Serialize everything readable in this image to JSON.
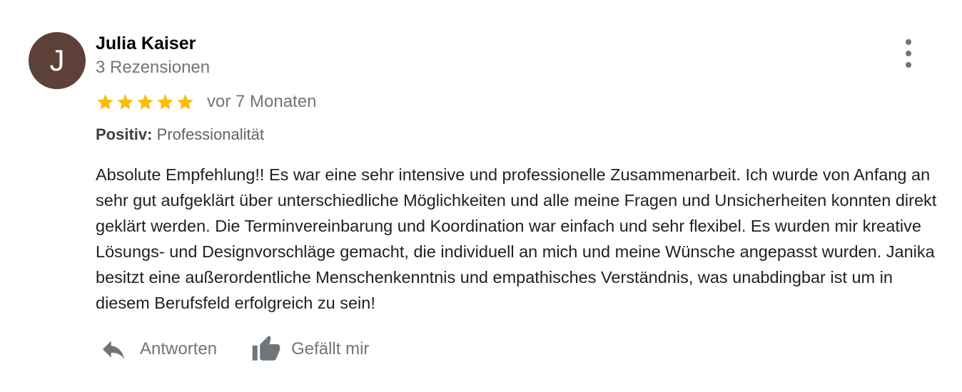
{
  "review": {
    "author_name": "Julia Kaiser",
    "author_initial": "J",
    "review_count": "3 Rezensionen",
    "rating": 5,
    "rating_max": 5,
    "time_ago": "vor 7 Monaten",
    "positive_label": "Positiv:",
    "positive_value": "Professionalität",
    "text": "Absolute Empfehlung!! Es war eine sehr intensive und professionelle Zusammenarbeit. Ich wurde von Anfang an sehr gut aufgeklärt über unterschiedliche Möglichkeiten und alle meine Fragen und Unsicherheiten konnten direkt geklärt werden. Die Terminvereinbarung und Koordination war einfach und sehr flexibel. Es wurden mir kreative Lösungs- und Designvorschläge gemacht, die individuell an mich und meine Wünsche angepasst wurden. Janika besitzt eine außerordentliche Menschenkenntnis und empathisches Verständnis, was unabdingbar ist um in diesem Berufsfeld erfolgreich zu sein!"
  },
  "actions": {
    "reply_label": "Antworten",
    "like_label": "Gefällt mir"
  },
  "icons": {
    "more": "more-vertical-icon",
    "star": "star-icon",
    "reply": "reply-arrow-icon",
    "like": "thumbs-up-icon"
  },
  "colors": {
    "avatar_bg": "#5d4037",
    "star": "#fbbc04",
    "secondary_text": "#70757a"
  }
}
